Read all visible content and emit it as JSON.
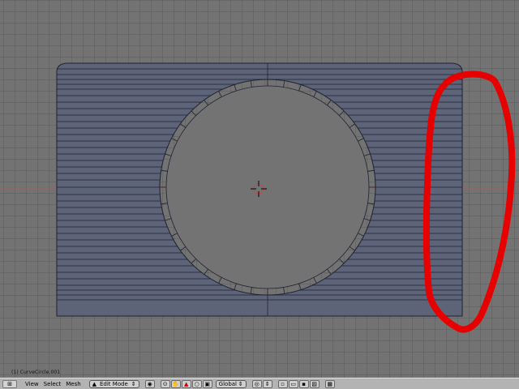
{
  "viewport": {
    "object_info": "(1) CurveCircle.001",
    "annotation": {
      "shape": "freehand-ellipse",
      "color": "#e60000"
    }
  },
  "header": {
    "editor_type_icon": "3d-view-icon",
    "menus": [
      "View",
      "Select",
      "Mesh"
    ],
    "mode_icon": "edit-mode-icon",
    "mode": "Edit Mode",
    "orientation": "Global"
  },
  "colors": {
    "viewport_bg": "#737373",
    "mesh_fill": "#5d6378",
    "mesh_edge": "#1e2230",
    "header_bg": "#b3b3b3",
    "annotation": "#e60000"
  }
}
